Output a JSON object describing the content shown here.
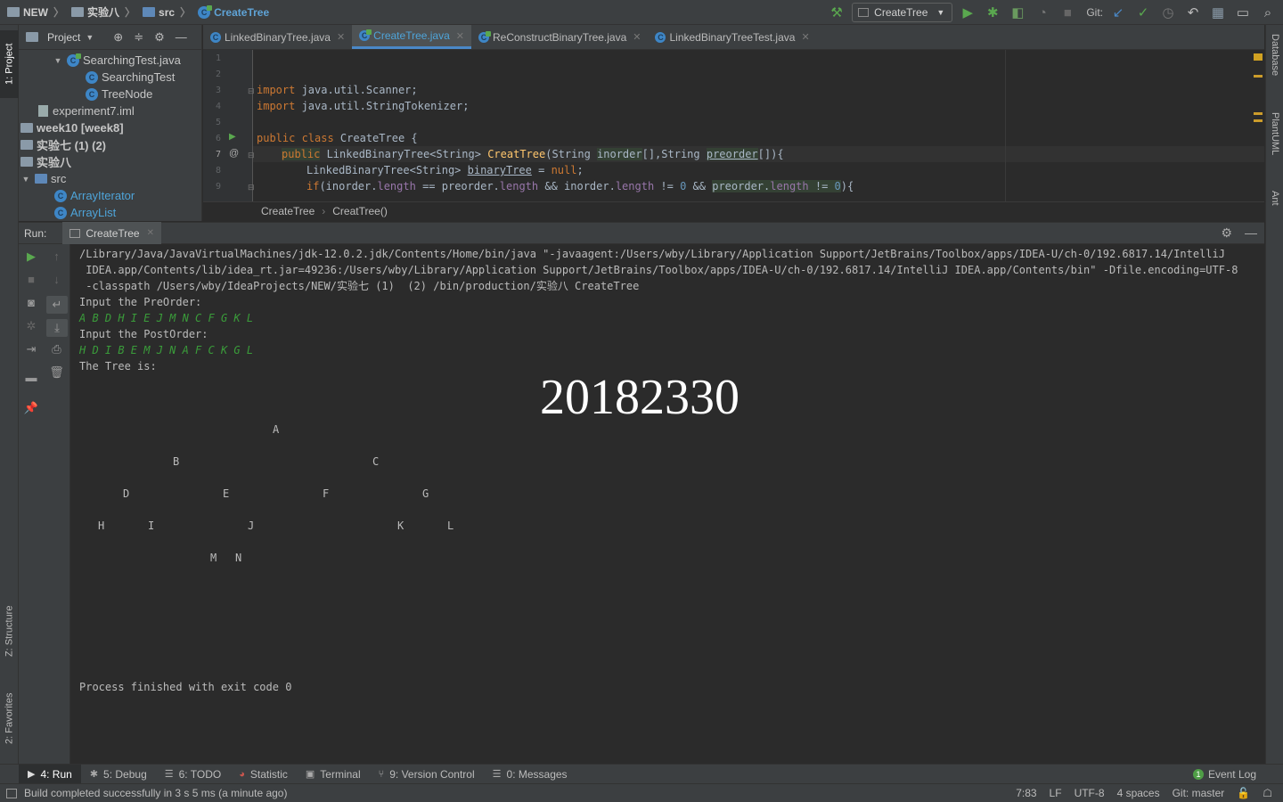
{
  "navbar": {
    "crumbs": [
      "NEW",
      "实验八",
      "src",
      "CreateTree"
    ],
    "run_config": "CreateTree",
    "git_label": "Git:"
  },
  "left_tabs": {
    "project": "1: Project",
    "structure": "Z: Structure",
    "favorites": "2: Favorites"
  },
  "right_tabs": {
    "database": "Database",
    "plantuml": "PlantUML",
    "ant": "Ant"
  },
  "project_panel": {
    "title": "Project",
    "items": [
      {
        "label": "SearchingTest.java"
      },
      {
        "label": "SearchingTest"
      },
      {
        "label": "TreeNode"
      },
      {
        "label": "experiment7.iml"
      },
      {
        "label": "week10 [week8]"
      },
      {
        "label": "实验七 (1)  (2)"
      },
      {
        "label": "实验八"
      },
      {
        "label": "src"
      },
      {
        "label": "ArrayIterator"
      },
      {
        "label": "ArrayList"
      }
    ]
  },
  "editor_tabs": [
    {
      "label": "LinkedBinaryTree.java"
    },
    {
      "label": "CreateTree.java"
    },
    {
      "label": "ReConstructBinaryTree.java"
    },
    {
      "label": "LinkedBinaryTreeTest.java"
    }
  ],
  "editor": {
    "line_numbers": [
      "1",
      "2",
      "3",
      "4",
      "5",
      "6",
      "7",
      "8",
      "9"
    ],
    "line3_kw": "import",
    "line3_rest": " java.util.Scanner;",
    "line4_kw": "import",
    "line4_rest": " java.util.StringTokenizer;",
    "line6_kw": "public class",
    "line6_rest": " CreateTree {",
    "line7": {
      "kw": "public",
      "type": " LinkedBinaryTree<String> ",
      "method": "CreatTree",
      "p1": "(String ",
      "arg1": "inorder",
      "p2": "[],String ",
      "arg2": "preorder",
      "p3": "[]){"
    },
    "line8": {
      "type": "LinkedBinaryTree<String> ",
      "var": "binaryTree",
      "eq": " = ",
      "null": "null",
      "end": ";"
    },
    "line9": {
      "kw": "if",
      "a": "(inorder.",
      "f1": "length",
      "b": " == preorder.",
      "f2": "length",
      "c": " && inorder.",
      "f3": "length",
      "d": " != ",
      "z1": "0",
      "e": " && ",
      "g": "preorder.",
      "f4": "length",
      "h": " != ",
      "z2": "0",
      "i": "){"
    }
  },
  "editor_breadcrumbs": [
    "CreateTree",
    "CreatTree()"
  ],
  "run_panel": {
    "label": "Run:",
    "tab": "CreateTree"
  },
  "console": {
    "cmd1": "/Library/Java/JavaVirtualMachines/jdk-12.0.2.jdk/Contents/Home/bin/java \"-javaagent:/Users/wby/Library/Application Support/JetBrains/Toolbox/apps/IDEA-U/ch-0/192.6817.14/IntelliJ",
    "cmd2": " IDEA.app/Contents/lib/idea_rt.jar=49236:/Users/wby/Library/Application Support/JetBrains/Toolbox/apps/IDEA-U/ch-0/192.6817.14/IntelliJ IDEA.app/Contents/bin\" -Dfile.encoding=UTF-8",
    "cmd3": " -classpath /Users/wby/IdeaProjects/NEW/实验七 (1)  (2) /bin/production/实验八 CreateTree",
    "prompt_pre": "Input the PreOrder:",
    "input_pre": "A B D H I E J M N C F G K L",
    "prompt_post": "Input the PostOrder:",
    "input_post": "H D I B E M J N A F C K G L",
    "tree_label": "The Tree is:",
    "watermark": "20182330",
    "tree_nodes": [
      "A",
      "B",
      "C",
      "D",
      "E",
      "F",
      "G",
      "H",
      "I",
      "J",
      "K",
      "L",
      "M",
      "N"
    ],
    "exit": "Process finished with exit code 0"
  },
  "bottom_tabs": [
    {
      "label": "4: Run"
    },
    {
      "label": "5: Debug"
    },
    {
      "label": "6: TODO"
    },
    {
      "label": "Statistic"
    },
    {
      "label": "Terminal"
    },
    {
      "label": "9: Version Control"
    },
    {
      "label": "0: Messages"
    }
  ],
  "event_log": {
    "count": "1",
    "label": "Event Log"
  },
  "status": {
    "message": "Build completed successfully in 3 s 5 ms (a minute ago)",
    "position": "7:83",
    "line_sep": "LF",
    "encoding": "UTF-8",
    "indent": "4 spaces",
    "git": "Git: master"
  },
  "colors": {
    "background": "#2b2b2b",
    "panel": "#3c3f41",
    "keyword": "#cc7832",
    "method": "#ffc66d",
    "field": "#9876aa",
    "number": "#6897bb",
    "console_input": "#3a9c3a",
    "accent": "#4a88c7"
  }
}
